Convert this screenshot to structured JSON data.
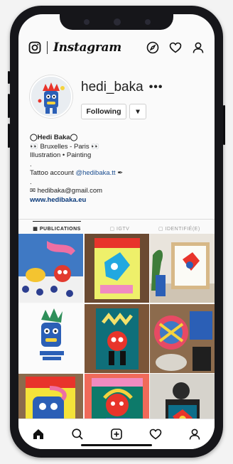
{
  "app": {
    "name": "Instagram"
  },
  "profile": {
    "username": "hedi_baka",
    "more": "•••",
    "follow_label": "Following",
    "dropdown_label": "▾"
  },
  "bio": {
    "display_name": "◯Hedi Baka◯",
    "location": "👀 Bruxelles - Paris 👀",
    "category": "Illustration • Painting",
    "dot1": ".",
    "tattoo_text": "Tattoo account ",
    "tattoo_handle": "@hedibaka.tt",
    "tattoo_emoji": "✒",
    "dot2": ".",
    "email": "✉ hedibaka@gmail.com",
    "website": "www.hedibaka.eu"
  },
  "tabs": [
    {
      "label": "▦ PUBLICATIONS"
    },
    {
      "label": "▢ IGTV"
    },
    {
      "label": "▢ IDENTIFIÉ(E)"
    }
  ],
  "posts": [
    {
      "label": "post-1"
    },
    {
      "label": "post-2"
    },
    {
      "label": "post-3"
    },
    {
      "label": "post-4"
    },
    {
      "label": "post-5"
    },
    {
      "label": "post-6"
    },
    {
      "label": "post-7"
    },
    {
      "label": "post-8"
    },
    {
      "label": "post-9"
    }
  ],
  "colors": {
    "link": "#0b3a7a",
    "text": "#222222",
    "frame": "#16161a"
  }
}
